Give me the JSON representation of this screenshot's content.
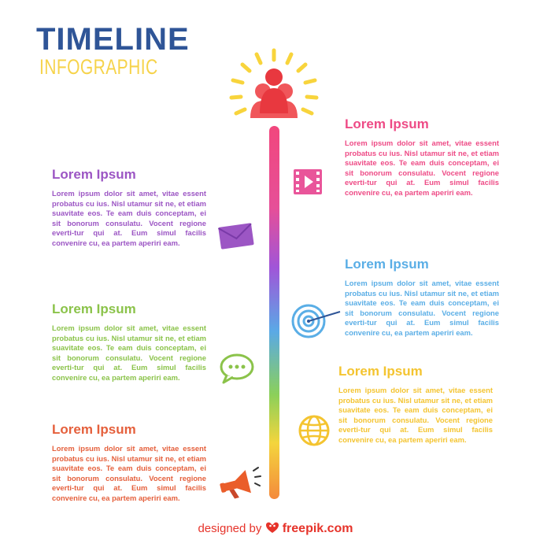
{
  "header": {
    "title": "TIMELINE",
    "subtitle": "INFOGRAPHIC"
  },
  "colors": {
    "title": "#2f5597",
    "subtitle": "#f6d34b",
    "pink": "#ee4b86",
    "purple": "#9c56c4",
    "blue": "#5aaee6",
    "green": "#8bc34a",
    "yellow": "#f4c430",
    "orange": "#e5603c",
    "footer": "#e6332a"
  },
  "entries": [
    {
      "side": "right",
      "heading": "Lorem Ipsum",
      "body": "Lorem ipsum dolor sit amet, vitae essent probatus cu ius. Nisl utamur sit ne, et etiam suavitate eos. Te eam duis conceptam, ei sit bonorum consulatu. Vocent regione everti-tur qui at. Eum simul facilis convenire cu, ea partem aperiri eam.",
      "color": "#ee4b86",
      "icon": "film-play-icon"
    },
    {
      "side": "left",
      "heading": "Lorem Ipsum",
      "body": "Lorem ipsum dolor sit amet, vitae essent probatus cu ius. Nisl utamur sit ne, et etiam suavitate eos. Te eam duis conceptam, ei sit bonorum consulatu. Vocent regione everti-tur qui at. Eum simul facilis convenire cu, ea partem aperiri eam.",
      "color": "#9c56c4",
      "icon": "envelope-icon"
    },
    {
      "side": "right",
      "heading": "Lorem Ipsum",
      "body": "Lorem ipsum dolor sit amet, vitae essent probatus cu ius. Nisl utamur sit ne, et etiam suavitate eos. Te eam duis conceptam, ei sit bonorum consulatu. Vocent regione everti-tur qui at. Eum simul facilis convenire cu, ea partem aperiri eam.",
      "color": "#5aaee6",
      "icon": "target-icon"
    },
    {
      "side": "left",
      "heading": "Lorem Ipsum",
      "body": "Lorem ipsum dolor sit amet, vitae essent probatus cu ius. Nisl utamur sit ne, et etiam suavitate eos. Te eam duis conceptam, ei sit bonorum consulatu. Vocent regione everti-tur qui at. Eum simul facilis convenire cu, ea partem aperiri eam.",
      "color": "#8bc34a",
      "icon": "chat-bubble-icon"
    },
    {
      "side": "right",
      "heading": "Lorem Ipsum",
      "body": "Lorem ipsum dolor sit amet, vitae essent probatus cu ius. Nisl utamur sit ne, et etiam suavitate eos. Te eam duis conceptam, ei sit bonorum consulatu. Vocent regione everti-tur qui at. Eum simul facilis convenire cu, ea partem aperiri eam.",
      "color": "#f4c430",
      "icon": "globe-icon"
    },
    {
      "side": "left",
      "heading": "Lorem Ipsum",
      "body": "Lorem ipsum dolor sit amet, vitae essent probatus cu ius. Nisl utamur sit ne, et etiam suavitate eos. Te eam duis conceptam, ei sit bonorum consulatu. Vocent regione everti-tur qui at. Eum simul facilis convenire cu, ea partem aperiri eam.",
      "color": "#e5603c",
      "icon": "megaphone-icon"
    }
  ],
  "top_icon": "people-group-icon",
  "footer": {
    "prefix": "designed by",
    "brand": "freepik.com",
    "logo_icon": "freepik-logo-icon"
  }
}
